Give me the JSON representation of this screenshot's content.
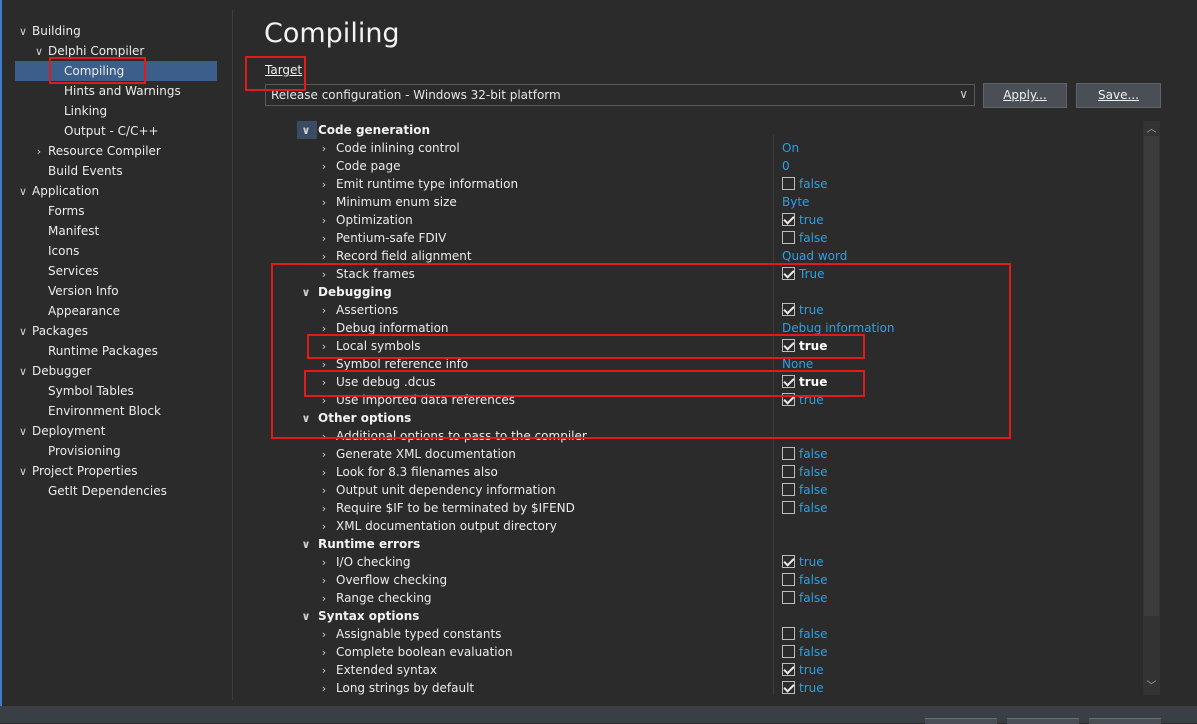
{
  "tree": {
    "items": [
      {
        "label": "Building",
        "chev": "∨",
        "indent": 0
      },
      {
        "label": "Delphi Compiler",
        "chev": "∨",
        "indent": 1
      },
      {
        "label": "Compiling",
        "chev": "",
        "indent": 2
      },
      {
        "label": "Hints and Warnings",
        "chev": "",
        "indent": 2
      },
      {
        "label": "Linking",
        "chev": "",
        "indent": 2
      },
      {
        "label": "Output - C/C++",
        "chev": "",
        "indent": 2
      },
      {
        "label": "Resource Compiler",
        "chev": "›",
        "indent": 1
      },
      {
        "label": "Build Events",
        "chev": "",
        "indent": 1
      },
      {
        "label": "Application",
        "chev": "∨",
        "indent": 0
      },
      {
        "label": "Forms",
        "chev": "",
        "indent": 1
      },
      {
        "label": "Manifest",
        "chev": "",
        "indent": 1
      },
      {
        "label": "Icons",
        "chev": "",
        "indent": 1
      },
      {
        "label": "Services",
        "chev": "",
        "indent": 1
      },
      {
        "label": "Version Info",
        "chev": "",
        "indent": 1
      },
      {
        "label": "Appearance",
        "chev": "",
        "indent": 1
      },
      {
        "label": "Packages",
        "chev": "∨",
        "indent": 0
      },
      {
        "label": "Runtime Packages",
        "chev": "",
        "indent": 1
      },
      {
        "label": "Debugger",
        "chev": "∨",
        "indent": 0
      },
      {
        "label": "Symbol Tables",
        "chev": "",
        "indent": 1
      },
      {
        "label": "Environment Block",
        "chev": "",
        "indent": 1
      },
      {
        "label": "Deployment",
        "chev": "∨",
        "indent": 0
      },
      {
        "label": "Provisioning",
        "chev": "",
        "indent": 1
      },
      {
        "label": "Project Properties",
        "chev": "∨",
        "indent": 0
      },
      {
        "label": "GetIt Dependencies",
        "chev": "",
        "indent": 1
      }
    ]
  },
  "header": {
    "title": "Compiling",
    "target_label": "Target",
    "target_value": "Release configuration - Windows 32-bit platform",
    "apply_label": "Apply...",
    "save_label": "Save..."
  },
  "grid": {
    "rows": [
      {
        "type": "cat",
        "label": "Code generation"
      },
      {
        "type": "prop",
        "label": "Code inlining control",
        "value": "On",
        "cb": "none"
      },
      {
        "type": "prop",
        "label": "Code page",
        "value": "0",
        "cb": "none"
      },
      {
        "type": "prop",
        "label": "Emit runtime type information",
        "value": "false",
        "cb": "off"
      },
      {
        "type": "prop",
        "label": "Minimum enum size",
        "value": "Byte",
        "cb": "none"
      },
      {
        "type": "prop",
        "label": "Optimization",
        "value": "true",
        "cb": "on"
      },
      {
        "type": "prop",
        "label": "Pentium-safe FDIV",
        "value": "false",
        "cb": "off"
      },
      {
        "type": "prop",
        "label": "Record field alignment",
        "value": "Quad word",
        "cb": "none"
      },
      {
        "type": "prop",
        "label": "Stack frames",
        "value": "True",
        "cb": "on"
      },
      {
        "type": "cat",
        "label": "Debugging"
      },
      {
        "type": "prop",
        "label": "Assertions",
        "value": "true",
        "cb": "on"
      },
      {
        "type": "prop",
        "label": "Debug information",
        "value": "Debug information",
        "cb": "none"
      },
      {
        "type": "prop",
        "label": "Local symbols",
        "value": "true",
        "cb": "on",
        "bold": true
      },
      {
        "type": "prop",
        "label": "Symbol reference info",
        "value": "None",
        "cb": "none"
      },
      {
        "type": "prop",
        "label": "Use debug .dcus",
        "value": "true",
        "cb": "on",
        "bold": true
      },
      {
        "type": "prop",
        "label": "Use imported data references",
        "value": "true",
        "cb": "on"
      },
      {
        "type": "cat",
        "label": "Other options"
      },
      {
        "type": "prop",
        "label": "Additional options to pass to the compiler",
        "value": "",
        "cb": "none"
      },
      {
        "type": "prop",
        "label": "Generate XML documentation",
        "value": "false",
        "cb": "off"
      },
      {
        "type": "prop",
        "label": "Look for 8.3 filenames also",
        "value": "false",
        "cb": "off"
      },
      {
        "type": "prop",
        "label": "Output unit dependency information",
        "value": "false",
        "cb": "off"
      },
      {
        "type": "prop",
        "label": "Require $IF to be terminated by $IFEND",
        "value": "false",
        "cb": "off"
      },
      {
        "type": "prop",
        "label": "XML documentation output directory",
        "value": "",
        "cb": "none"
      },
      {
        "type": "cat",
        "label": "Runtime errors"
      },
      {
        "type": "prop",
        "label": "I/O checking",
        "value": "true",
        "cb": "on"
      },
      {
        "type": "prop",
        "label": "Overflow checking",
        "value": "false",
        "cb": "off"
      },
      {
        "type": "prop",
        "label": "Range checking",
        "value": "false",
        "cb": "off"
      },
      {
        "type": "cat",
        "label": "Syntax options"
      },
      {
        "type": "prop",
        "label": "Assignable typed constants",
        "value": "false",
        "cb": "off"
      },
      {
        "type": "prop",
        "label": "Complete boolean evaluation",
        "value": "false",
        "cb": "off"
      },
      {
        "type": "prop",
        "label": "Extended syntax",
        "value": "true",
        "cb": "on"
      },
      {
        "type": "prop",
        "label": "Long strings by default",
        "value": "true",
        "cb": "on"
      }
    ]
  },
  "icons": {
    "chevron_right": "chevron-right-icon",
    "chevron_down": "chevron-down-icon"
  },
  "colors": {
    "selection": "#3b5f8a",
    "value_blue": "#2aa0e6",
    "highlight_red": "#e11b1b",
    "background": "#2b2b2b"
  }
}
